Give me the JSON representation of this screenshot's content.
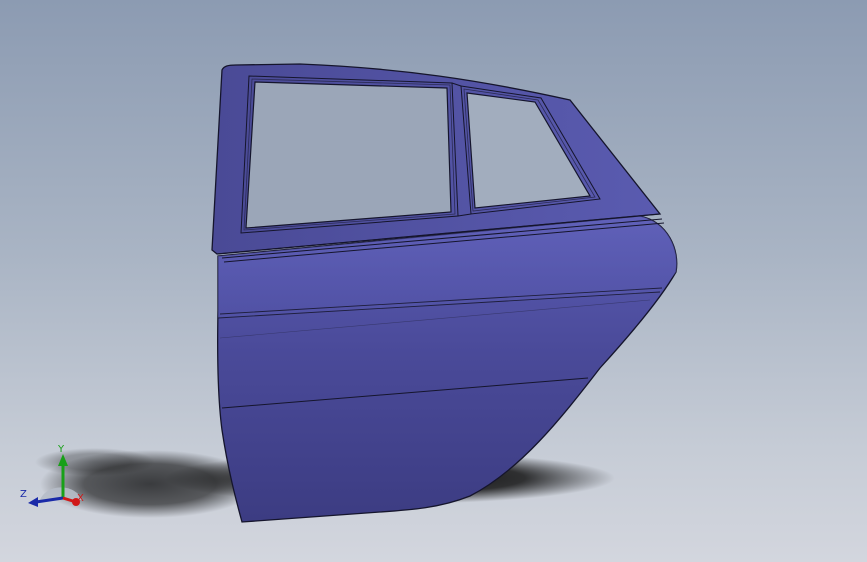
{
  "viewport": {
    "background_top": "#8c9bb2",
    "background_bottom": "#d3d6de"
  },
  "model": {
    "part": "rear-car-door",
    "body_color": "#4f4fa0",
    "edge_color": "#15152c"
  },
  "triad": {
    "x_label": "X",
    "y_label": "Y",
    "z_label": "Z",
    "x_color": "#d01818",
    "y_color": "#18a018",
    "z_color": "#1a2aa8"
  }
}
